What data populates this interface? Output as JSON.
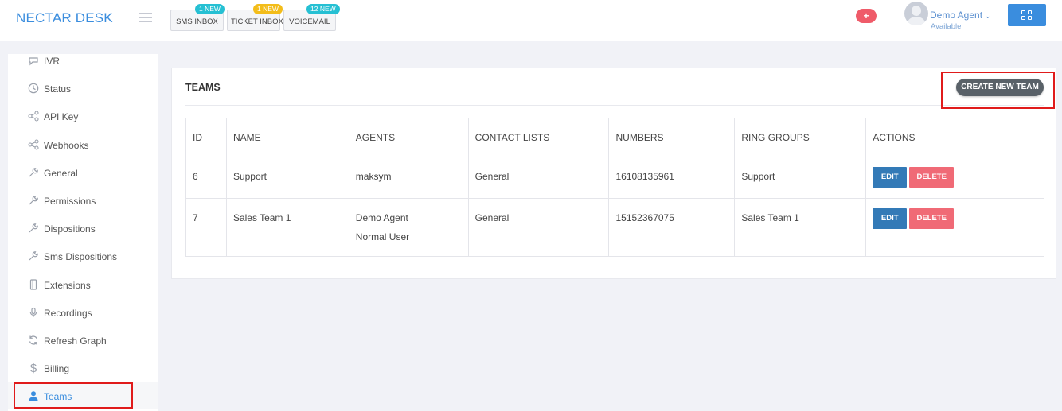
{
  "header": {
    "brand": "NECTAR DESK",
    "inboxes": [
      {
        "label": "SMS INBOX",
        "badge": "1 NEW",
        "badge_color": "#26c0d3"
      },
      {
        "label": "TICKET INBOX",
        "badge": "1 NEW",
        "badge_color": "#f3bd1a"
      },
      {
        "label": "VOICEMAIL",
        "badge": "12 NEW",
        "badge_color": "#26c0d3"
      }
    ],
    "plus_icon": "+",
    "user": {
      "name": "Demo Agent",
      "status": "Available",
      "chevron": "⌄"
    }
  },
  "sidebar": {
    "items": [
      {
        "label": "IVR",
        "icon": "ivr-icon"
      },
      {
        "label": "Status",
        "icon": "clock-icon"
      },
      {
        "label": "API Key",
        "icon": "share-icon"
      },
      {
        "label": "Webhooks",
        "icon": "share-icon"
      },
      {
        "label": "General",
        "icon": "wrench-icon"
      },
      {
        "label": "Permissions",
        "icon": "wrench-icon"
      },
      {
        "label": "Dispositions",
        "icon": "wrench-icon"
      },
      {
        "label": "Sms Dispositions",
        "icon": "wrench-icon"
      },
      {
        "label": "Extensions",
        "icon": "phone-icon"
      },
      {
        "label": "Recordings",
        "icon": "microphone-icon"
      },
      {
        "label": "Refresh Graph",
        "icon": "refresh-icon"
      },
      {
        "label": "Billing",
        "icon": "dollar-icon"
      },
      {
        "label": "Teams",
        "icon": "user-icon",
        "active": true
      }
    ]
  },
  "main": {
    "title": "TEAMS",
    "create_label": "CREATE NEW TEAM",
    "table": {
      "columns": [
        "ID",
        "NAME",
        "AGENTS",
        "CONTACT LISTS",
        "NUMBERS",
        "RING GROUPS",
        "ACTIONS"
      ],
      "rows": [
        {
          "id": "6",
          "name": "Support",
          "agents": [
            "maksym"
          ],
          "contact_lists": "General",
          "numbers": "16108135961",
          "ring_groups": "Support"
        },
        {
          "id": "7",
          "name": "Sales Team 1",
          "agents": [
            "Demo Agent",
            "Normal User"
          ],
          "contact_lists": "General",
          "numbers": "15152367075",
          "ring_groups": "Sales Team 1"
        }
      ],
      "edit_label": "EDIT",
      "delete_label": "DELETE"
    }
  },
  "colors": {
    "accent": "#3a8dde",
    "edit": "#337ab7",
    "delete": "#f06a76",
    "highlight": "#e01b1b"
  }
}
